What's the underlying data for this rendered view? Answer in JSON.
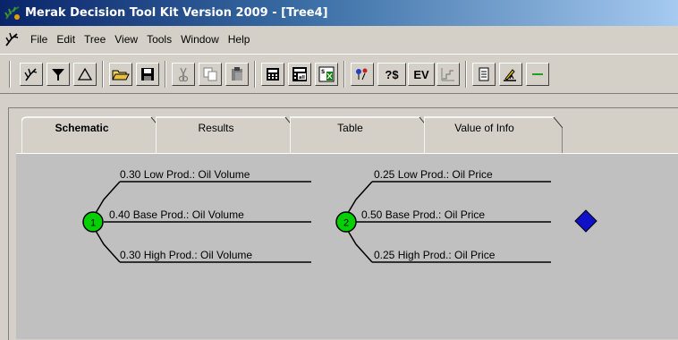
{
  "window": {
    "title": "Merak Decision Tool Kit Version 2009 - [Tree4]"
  },
  "menu": {
    "items": [
      "File",
      "Edit",
      "Tree",
      "View",
      "Tools",
      "Window",
      "Help"
    ]
  },
  "toolbar": {
    "money_label": "?$",
    "ev_label": "EV"
  },
  "tabs": [
    {
      "label": "Schematic",
      "active": true
    },
    {
      "label": "Results",
      "active": false
    },
    {
      "label": "Table",
      "active": false
    },
    {
      "label": "Value of Info",
      "active": false
    }
  ],
  "tree": {
    "nodes": [
      {
        "number": "1",
        "color": "#00d000"
      },
      {
        "number": "2",
        "color": "#00d000"
      }
    ],
    "terminal_color": "#1010c8",
    "branches_node1": [
      {
        "text": "0.30 Low Prod.:  Oil Volume"
      },
      {
        "text": "0.40 Base Prod.:  Oil Volume"
      },
      {
        "text": "0.30 High Prod.:  Oil Volume"
      }
    ],
    "branches_node2": [
      {
        "text": "0.25 Low Prod.:  Oil Price"
      },
      {
        "text": "0.50 Base Prod.:  Oil Price"
      },
      {
        "text": "0.25 High Prod.:  Oil Price"
      }
    ]
  }
}
